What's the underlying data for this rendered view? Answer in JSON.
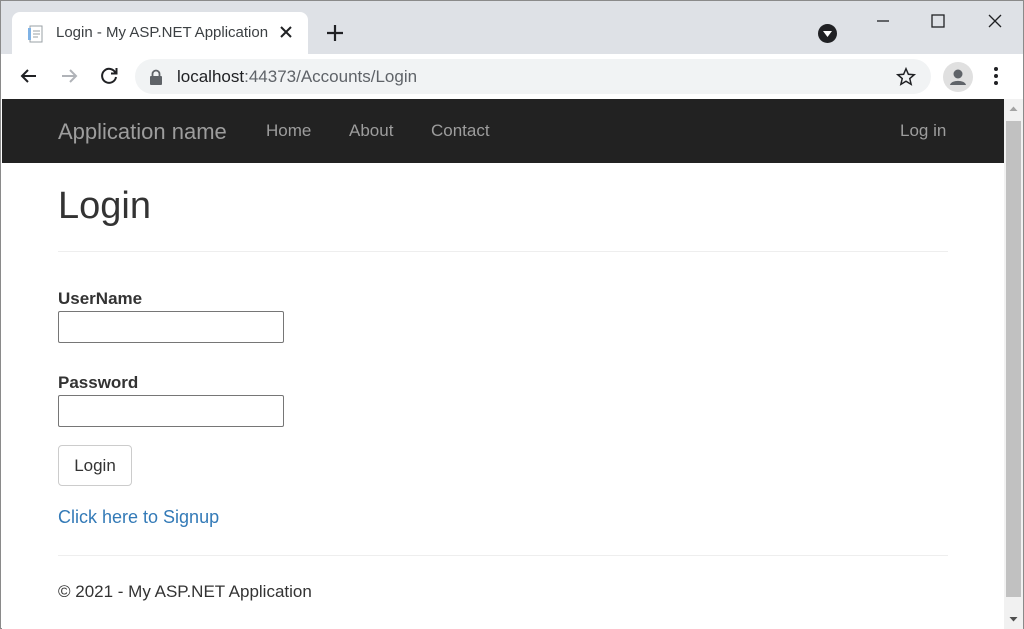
{
  "browser": {
    "tab_title": "Login - My ASP.NET Application",
    "url_host": "localhost",
    "url_rest": ":44373/Accounts/Login",
    "icons": {
      "favicon": "page-icon",
      "tab_close": "close-icon",
      "new_tab": "plus-icon",
      "back": "arrow-left-icon",
      "forward": "arrow-right-icon",
      "reload": "reload-icon",
      "lock": "lock-icon",
      "bookmark": "star-icon",
      "profile": "person-icon",
      "menu": "kebab-icon"
    }
  },
  "navbar": {
    "brand": "Application name",
    "links": [
      "Home",
      "About",
      "Contact"
    ],
    "login_link": "Log in",
    "background": "#222222",
    "link_color": "#9d9d9d"
  },
  "page": {
    "title": "Login",
    "username_label": "UserName",
    "username_value": "",
    "password_label": "Password",
    "password_value": "",
    "submit_label": "Login",
    "signup_link": "Click here to Signup",
    "link_color": "#337ab7"
  },
  "footer": {
    "text": "© 2021 - My ASP.NET Application"
  }
}
